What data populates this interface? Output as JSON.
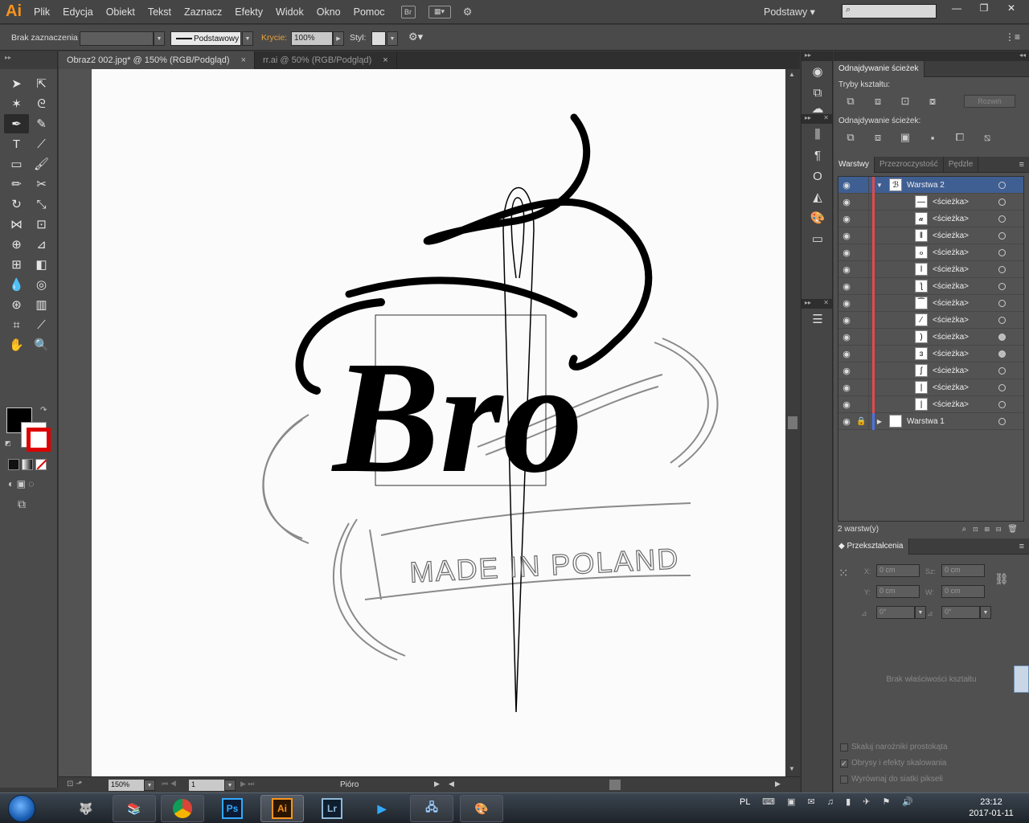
{
  "app": {
    "logo": "Ai",
    "menu": [
      "Plik",
      "Edycja",
      "Obiekt",
      "Tekst",
      "Zaznacz",
      "Efekty",
      "Widok",
      "Okno",
      "Pomoc"
    ],
    "bridge_label": "Br",
    "workspace": "Podstawy",
    "brand_color": "#f7941d"
  },
  "control_bar": {
    "selection_status": "Brak zaznaczenia",
    "stroke_style": "Podstawowy",
    "opacity_label": "Krycie:",
    "opacity_value": "100%",
    "style_label": "Styl:",
    "opacity_label_color": "#e8a33d"
  },
  "tabs": [
    {
      "label": "Obraz2 002.jpg* @ 150% (RGB/Podgląd)",
      "close": "×",
      "active": true
    },
    {
      "label": "rr.ai @ 50% (RGB/Podgląd)",
      "close": "×",
      "active": false
    }
  ],
  "canvas": {
    "lettering": "Bro",
    "banner_text": "MADE IN POLAND"
  },
  "status_bar": {
    "zoom": "150%",
    "page": "1",
    "tool": "Pióro"
  },
  "pathfinder": {
    "title": "Odnajdywanie ścieżek",
    "shape_modes_label": "Tryby kształtu:",
    "pathfinders_label": "Odnajdywanie ścieżek:",
    "expand_button": "Rozwiń"
  },
  "layers_panel": {
    "tabs": [
      "Warstwy",
      "Przezroczystość",
      "Pędzle"
    ],
    "layer2": "Warstwa 2",
    "path_label": "<ścieżka>",
    "path_count_glyphs": [
      "—",
      "𝒶",
      "ǁ",
      "ℴ",
      "ǀ",
      "ƪ",
      "⁀",
      "⁄",
      ")",
      "ɜ",
      "ʃ",
      "|",
      "|"
    ],
    "layer1": "Warstwa 1",
    "footer_count": "2 warstw(y)"
  },
  "transform": {
    "title": "Przekształcenia",
    "x_label": "X:",
    "x_value": "0 cm",
    "y_label": "Y:",
    "y_value": "0 cm",
    "w_label": "Sz:",
    "w_value": "0 cm",
    "h_label": "W:",
    "h_value": "0 cm",
    "angle_value": "0°",
    "shear_value": "0°",
    "no_shape": "Brak właściwości kształtu",
    "opt1": "Skaluj narożniki prostokąta",
    "opt2": "Obrysy i efekty skalowania",
    "opt3": "Wyrównaj do siatki pikseli"
  },
  "taskbar": {
    "apps": [
      "GIMP",
      "WinRAR",
      "Chrome",
      "Ps",
      "Ai",
      "Lr",
      "Media",
      "Network",
      "Paint"
    ],
    "lang": "PL",
    "time": "23:12",
    "date": "2017-01-11"
  }
}
